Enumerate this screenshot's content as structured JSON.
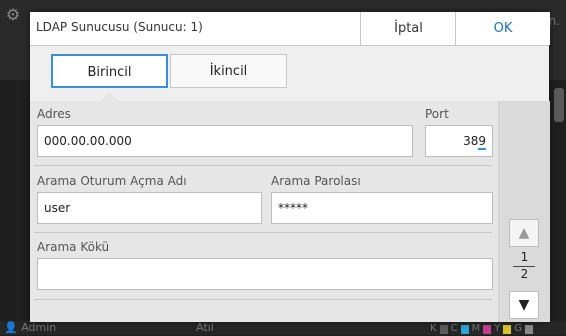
{
  "background": {
    "corner_text": "n.",
    "status_user": "Admin",
    "status_middle": "Atıl",
    "inks": [
      "K",
      "C",
      "M",
      "Y",
      "G"
    ],
    "ink_colors": {
      "K": "#777777",
      "C": "#2aa3d8",
      "M": "#c2418f",
      "Y": "#d8c42a",
      "G": "#8a8a8a"
    }
  },
  "dialog": {
    "title": "LDAP Sunucusu (Sunucu: 1)",
    "cancel_label": "İptal",
    "ok_label": "OK"
  },
  "tabs": {
    "primary": "Birincil",
    "secondary": "İkincil"
  },
  "form": {
    "address": {
      "label": "Adres",
      "value": "000.00.00.000"
    },
    "port": {
      "label": "Port",
      "value": "38",
      "value_last": "9"
    },
    "login_name": {
      "label": "Arama Oturum Açma Adı",
      "value": "user"
    },
    "password": {
      "label": "Arama Parolası",
      "value": "*****"
    },
    "search_root": {
      "label": "Arama Kökü",
      "value": ""
    }
  },
  "pager": {
    "up_icon": "▲",
    "down_icon": "▼",
    "current": "1",
    "total": "2"
  },
  "colors": {
    "accent": "#1a6fb4",
    "tab_active_border": "#3a8fd6"
  }
}
